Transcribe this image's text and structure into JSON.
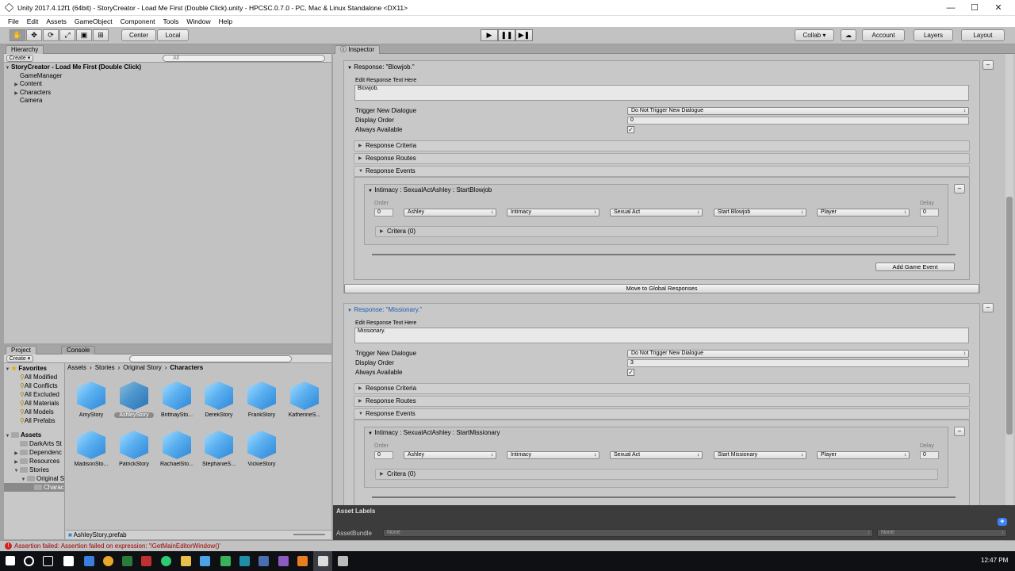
{
  "window": {
    "title": "Unity 2017.4.12f1 (64bit) - StoryCreator - Load Me First (Double Click).unity - HPCSC.0.7.0 - PC, Mac & Linux Standalone <DX11>",
    "min": "—",
    "max": "☐",
    "close": "✕"
  },
  "menu": [
    "File",
    "Edit",
    "Assets",
    "GameObject",
    "Component",
    "Tools",
    "Window",
    "Help"
  ],
  "toolbar": {
    "center": "Center",
    "local": "Local",
    "collab": "Collab ▾",
    "account": "Account",
    "layers": "Layers",
    "layout": "Layout"
  },
  "hierarchy": {
    "tab": "Hierarchy",
    "create": "Create ▾",
    "search": "All",
    "scene": "StoryCreator - Load Me First (Double Click)",
    "items": [
      "GameManager",
      "Content",
      "Characters",
      "Camera"
    ]
  },
  "project": {
    "tab": "Project",
    "console_tab": "Console",
    "create": "Create ▾",
    "favorites": {
      "label": "Favorites",
      "items": [
        "All Modified",
        "All Conflicts",
        "All Excluded",
        "All Materials",
        "All Models",
        "All Prefabs"
      ]
    },
    "assets": {
      "label": "Assets",
      "items": [
        "DarkArts St",
        "Dependenc",
        "Resources",
        "Stories",
        "Original S",
        "Charac"
      ]
    },
    "breadcrumb": [
      "Assets",
      "Stories",
      "Original Story",
      "Characters"
    ],
    "grid": [
      "AmyStory",
      "AshleyStory",
      "BrittnaySto...",
      "DerekStory",
      "FrankStory",
      "KatherineS...",
      "MadisonSto...",
      "PatrickStory",
      "RachaelSto...",
      "StephanieS...",
      "VickieStory"
    ],
    "selected_file": "AshleyStory.prefab"
  },
  "inspector": {
    "tab": "Inspector",
    "response1": {
      "title": "Response: \"Blowjob.\"",
      "edit_label": "Edit Response Text Here",
      "text": "Blowjob.",
      "trigger_label": "Trigger New Dialogue",
      "trigger_value": "Do Not Trigger New Dialogue",
      "order_label": "Display Order",
      "order_value": "0",
      "always_label": "Always Available",
      "criteria": "Response Criteria",
      "routes": "Response Routes",
      "events": "Response Events",
      "event_title": "Intimacy : SexualActAshley : StartBlowjob",
      "order_hdr": "Order",
      "delay_hdr": "Delay",
      "order": "0",
      "char": "Ashley",
      "cat": "Intimacy",
      "type": "Sexual Act",
      "action": "Start Blowjob",
      "target": "Player",
      "delay": "0",
      "critera": "Critera (0)",
      "add_event": "Add Game Event",
      "move_global": "Move to Global Responses"
    },
    "response2": {
      "title": "Response: \"Missionary.\"",
      "edit_label": "Edit Response Text Here",
      "text": "Missionary.",
      "trigger_label": "Trigger New Dialogue",
      "trigger_value": "Do Not Trigger New Dialogue",
      "order_label": "Display Order",
      "order_value": "3",
      "always_label": "Always Available",
      "criteria": "Response Criteria",
      "routes": "Response Routes",
      "events": "Response Events",
      "event_title": "Intimacy : SexualActAshley : StartMissionary",
      "order_hdr": "Order",
      "delay_hdr": "Delay",
      "order": "0",
      "char": "Ashley",
      "cat": "Intimacy",
      "type": "Sexual Act",
      "action": "Start Missionary",
      "target": "Player",
      "delay": "0",
      "critera": "Critera (0)"
    }
  },
  "asset_labels": {
    "title": "Asset Labels",
    "bundle_label": "AssetBundle",
    "bundle_value": "None",
    "variant_value": "None"
  },
  "status": "Assertion failed: Assertion failed on expression: '!GetMainEditorWindow()'",
  "taskbar": {
    "time": "12:47 PM"
  }
}
